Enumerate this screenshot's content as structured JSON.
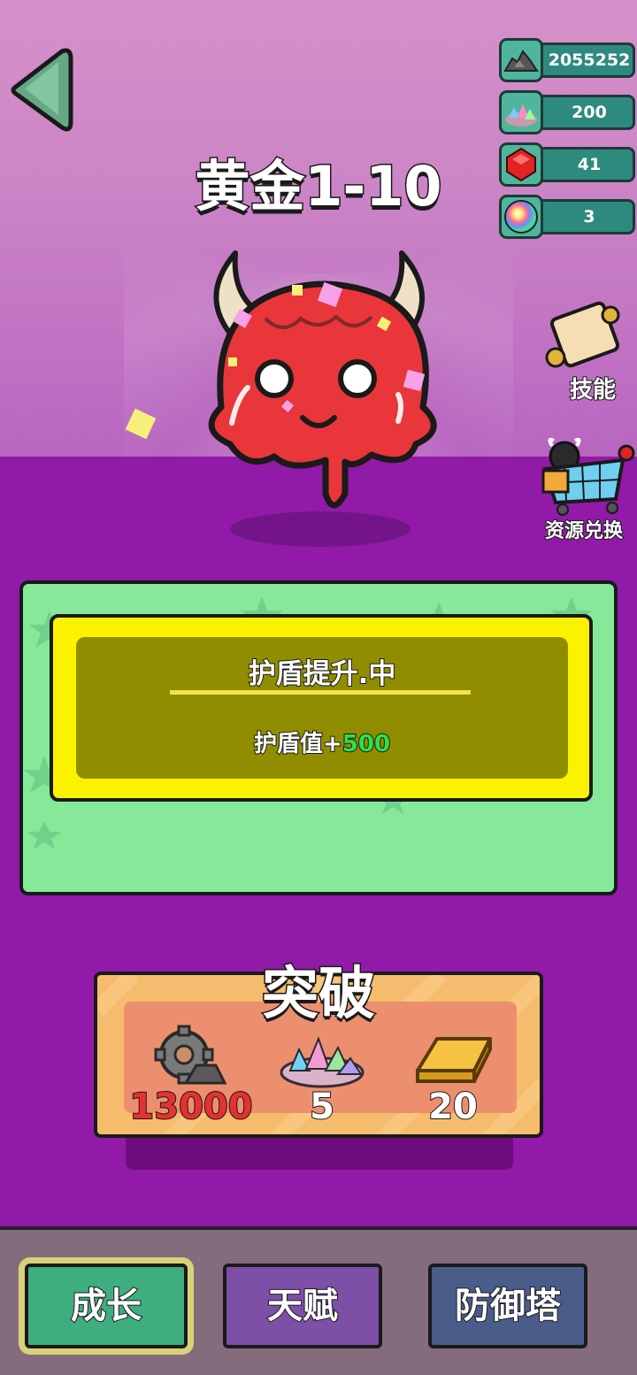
{
  "stage": {
    "title": "黄金1-10"
  },
  "resources": [
    {
      "icon": "ore-pile-icon",
      "value": "2055252"
    },
    {
      "icon": "crystal-pile-icon",
      "value": "200"
    },
    {
      "icon": "red-gem-icon",
      "value": "41"
    },
    {
      "icon": "rainbow-orb-icon",
      "value": "3"
    }
  ],
  "side_buttons": {
    "skills_label": "技能",
    "exchange_label": "资源兑换"
  },
  "upgrade": {
    "title": "护盾提升.中",
    "desc_prefix": "护盾值",
    "desc_sign": "+",
    "desc_value": "500"
  },
  "breakthrough": {
    "title": "突破",
    "costs": [
      {
        "icon": "gear-ore-icon",
        "value": "13000",
        "insufficient": true
      },
      {
        "icon": "crystal-pile-icon",
        "value": "5",
        "insufficient": false
      },
      {
        "icon": "gold-bar-icon",
        "value": "20",
        "insufficient": false
      }
    ]
  },
  "nav": {
    "growth": "成长",
    "talent": "天赋",
    "tower": "防御塔"
  },
  "colors": {
    "sky": "#cc85c6",
    "floor": "#921aa8",
    "panel_green": "#86e99a",
    "card_yellow": "#fbf200",
    "value_green": "#2ee04a",
    "cost_red": "#e53131",
    "nav_growth": "#3fae7e",
    "nav_talent": "#7d4fa6",
    "nav_tower": "#4a5d8a"
  }
}
